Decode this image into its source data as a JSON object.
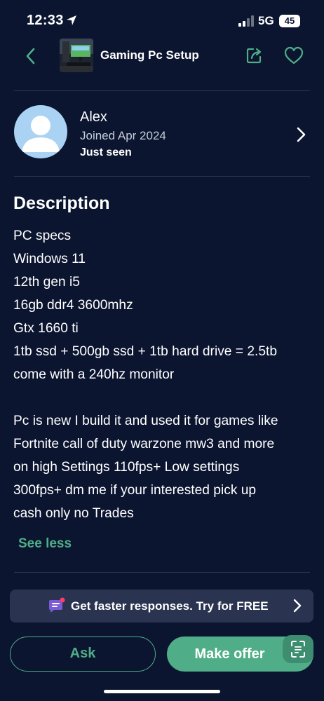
{
  "status_bar": {
    "time": "12:33",
    "network": "5G",
    "battery": "45",
    "icons": [
      "location-arrow-icon",
      "signal-bars-icon",
      "battery-icon"
    ]
  },
  "header": {
    "title": "Gaming Pc Setup",
    "icons": [
      "back-chevron-icon",
      "share-icon",
      "heart-icon"
    ]
  },
  "seller": {
    "name": "Alex",
    "joined": "Joined Apr 2024",
    "last_seen": "Just seen"
  },
  "description": {
    "heading": "Description",
    "lines": [
      "PC specs",
      "Windows 11",
      "12th gen i5",
      "16gb ddr4 3600mhz",
      "Gtx 1660 ti",
      "1tb ssd + 500gb ssd + 1tb hard drive = 2.5tb",
      "come with a 240hz monitor",
      "",
      "Pc is new I build it and used it for games like",
      "Fortnite call of duty warzone mw3 and more",
      "on high Settings 110fps+ Low settings",
      "300fps+ dm me if your interested pick up",
      "cash only no Trades"
    ],
    "toggle_label": "See less"
  },
  "promo": {
    "text": "Get faster responses. Try for FREE"
  },
  "actions": {
    "ask_label": "Ask",
    "offer_label": "Make offer"
  },
  "colors": {
    "background": "#0b1530",
    "accent": "#4fae87",
    "divider": "#2a3550",
    "promo_bg": "#2a3450",
    "avatar_bg": "#a9d2f3"
  }
}
